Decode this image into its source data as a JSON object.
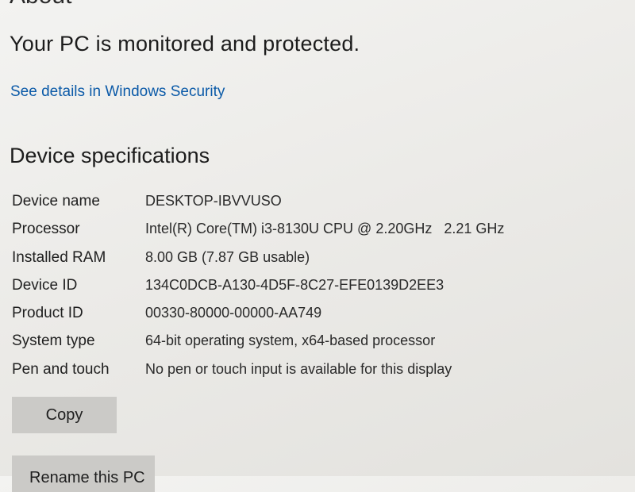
{
  "about": {
    "heading": "About"
  },
  "security": {
    "status": "Your PC is monitored and protected.",
    "link_label": "See details in Windows Security"
  },
  "device_specs": {
    "title": "Device specifications",
    "rows": [
      {
        "label": "Device name",
        "value": "DESKTOP-IBVVUSO"
      },
      {
        "label": "Processor",
        "value": "Intel(R) Core(TM) i3-8130U CPU @ 2.20GHz   2.21 GHz"
      },
      {
        "label": "Installed RAM",
        "value": "8.00 GB (7.87 GB usable)"
      },
      {
        "label": "Device ID",
        "value": "134C0DCB-A130-4D5F-8C27-EFE0139D2EE3"
      },
      {
        "label": "Product ID",
        "value": "00330-80000-00000-AA749"
      },
      {
        "label": "System type",
        "value": "64-bit operating system, x64-based processor"
      },
      {
        "label": "Pen and touch",
        "value": "No pen or touch input is available for this display"
      }
    ],
    "copy_label": "Copy"
  },
  "rename": {
    "label": "Rename this PC"
  },
  "colors": {
    "link": "#0b5aa8",
    "button_bg": "#cbcac7",
    "page_bg": "#eeeeec"
  }
}
